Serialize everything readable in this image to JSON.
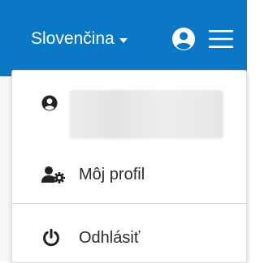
{
  "header": {
    "language_label": "Slovenčina",
    "icons": {
      "language_caret": "caret-down-icon",
      "user": "user-circle-icon",
      "menu": "hamburger-menu-icon"
    }
  },
  "dropdown": {
    "user_row": {
      "icon": "user-circle-icon",
      "name_redacted": true
    },
    "items": [
      {
        "label": "Môj profil",
        "icon": "user-gear-icon"
      },
      {
        "label": "Odhlásiť",
        "icon": "power-icon"
      }
    ]
  },
  "colors": {
    "header_bg": "#0b78c6",
    "header_fg": "#ffffff",
    "menu_text": "#2b2b2b"
  }
}
